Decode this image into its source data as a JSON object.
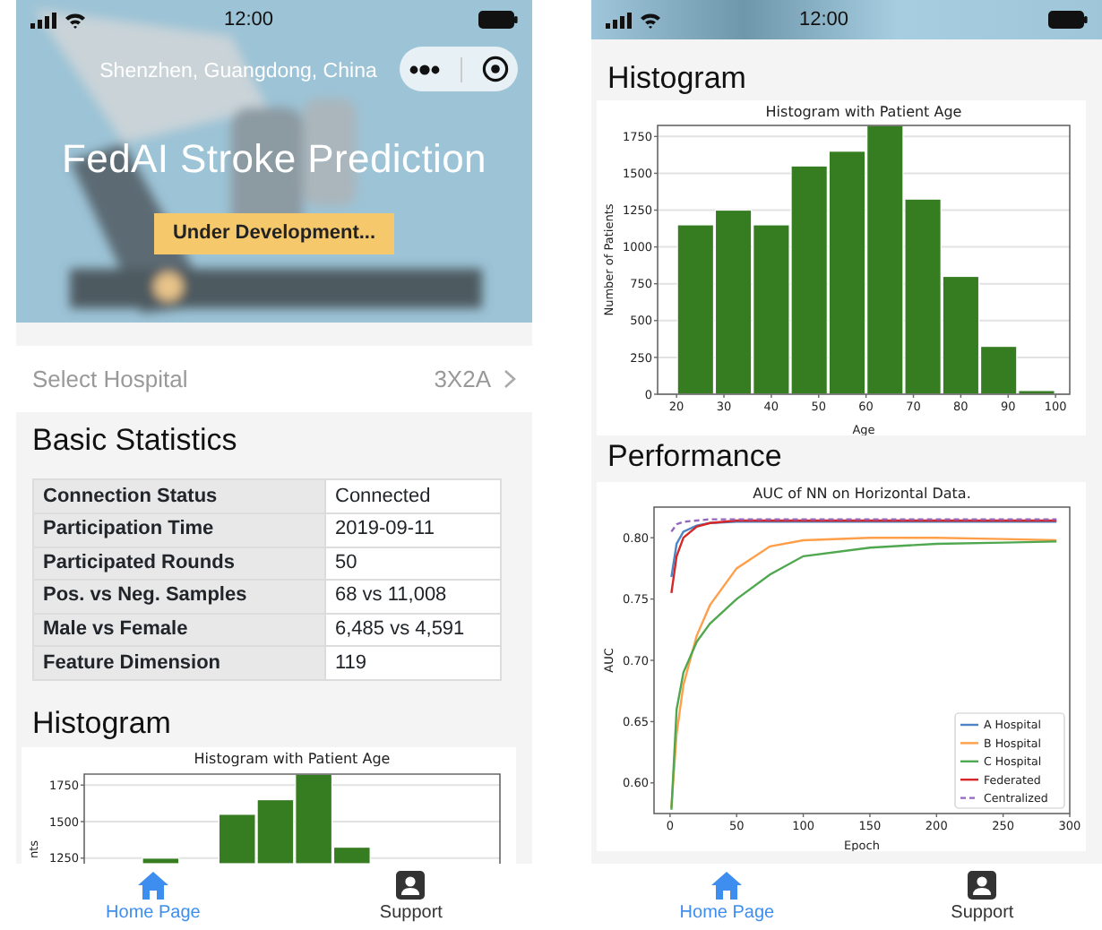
{
  "screens": [
    {
      "status_bar": {
        "time": "12:00"
      },
      "header": {
        "location": "Shenzhen, Guangdong, China",
        "title": "FedAI Stroke Prediction",
        "badge": "Under Development..."
      },
      "hospital_select": {
        "label": "Select Hospital",
        "value": "3X2A"
      },
      "basic_statistics": {
        "heading": "Basic Statistics",
        "rows": [
          {
            "label": "Connection Status",
            "value": "Connected"
          },
          {
            "label": "Participation Time",
            "value": "2019-09-11"
          },
          {
            "label": "Participated Rounds",
            "value": "50"
          },
          {
            "label": "Pos. vs Neg. Samples",
            "value": "68 vs 11,008"
          },
          {
            "label": "Male vs Female",
            "value": "6,485 vs 4,591"
          },
          {
            "label": "Feature Dimension",
            "value": "119"
          }
        ]
      },
      "histogram": {
        "heading": "Histogram",
        "chart_data": {
          "type": "bar",
          "title": "Histogram with Patient Age",
          "ylabel": "nts",
          "categories": [
            null,
            null,
            null,
            null,
            null,
            null,
            null,
            null,
            null,
            null
          ],
          "values": [
            null,
            1250,
            null,
            1550,
            1650,
            1825,
            1325,
            null,
            null,
            null
          ],
          "ylim": [
            1212,
            1825
          ],
          "yticks": [
            1250,
            1500,
            1750
          ],
          "grid": true
        }
      },
      "tab_bar": [
        {
          "label": "Home Page",
          "selected": true
        },
        {
          "label": "Support",
          "selected": false
        }
      ]
    },
    {
      "status_bar": {
        "time": "12:00"
      },
      "histogram": {
        "heading": "Histogram",
        "chart_data": {
          "type": "bar",
          "title": "Histogram with Patient Age",
          "xlabel": "Age",
          "ylabel": "Number of Patients",
          "x": [
            24,
            32,
            40,
            48,
            56,
            64,
            72,
            80,
            88,
            96
          ],
          "values": [
            1150,
            1250,
            1150,
            1550,
            1650,
            1825,
            1325,
            800,
            325,
            25
          ],
          "xlim": [
            16,
            103
          ],
          "ylim": [
            0,
            1825
          ],
          "xticks": [
            20,
            30,
            40,
            50,
            60,
            70,
            80,
            90,
            100
          ],
          "yticks": [
            0,
            250,
            500,
            750,
            1000,
            1250,
            1500,
            1750
          ],
          "grid": true
        }
      },
      "performance": {
        "heading": "Performance",
        "chart_data": {
          "type": "line",
          "title": "AUC of NN on Horizontal Data.",
          "xlabel": "Epoch",
          "ylabel": "AUC",
          "x": [
            1,
            5,
            10,
            20,
            30,
            50,
            75,
            100,
            150,
            200,
            250,
            290
          ],
          "series": [
            {
              "name": "A Hospital",
              "color": "#4c84c4",
              "line_style": "solid",
              "values": [
                0.768,
                0.795,
                0.805,
                0.81,
                0.812,
                0.813,
                0.813,
                0.813,
                0.813,
                0.813,
                0.813,
                0.813
              ]
            },
            {
              "name": "B Hospital",
              "color": "#ff9f4a",
              "line_style": "solid",
              "values": [
                0.58,
                0.64,
                0.68,
                0.72,
                0.745,
                0.775,
                0.793,
                0.798,
                0.8,
                0.8,
                0.799,
                0.798
              ]
            },
            {
              "name": "C Hospital",
              "color": "#4fa84f",
              "line_style": "solid",
              "values": [
                0.578,
                0.66,
                0.69,
                0.715,
                0.73,
                0.75,
                0.77,
                0.785,
                0.792,
                0.795,
                0.796,
                0.797
              ]
            },
            {
              "name": "Federated",
              "color": "#d62728",
              "line_style": "solid",
              "values": [
                0.755,
                0.785,
                0.8,
                0.809,
                0.812,
                0.814,
                0.814,
                0.814,
                0.814,
                0.814,
                0.814,
                0.814
              ]
            },
            {
              "name": "Centralized",
              "color": "#9467bd",
              "line_style": "dashed",
              "values": [
                0.805,
                0.811,
                0.813,
                0.814,
                0.815,
                0.815,
                0.815,
                0.815,
                0.815,
                0.815,
                0.815,
                0.815
              ]
            }
          ],
          "legend": true,
          "xlim": [
            -12,
            300
          ],
          "ylim": [
            0.575,
            0.825
          ],
          "xticks": [
            0,
            50,
            100,
            150,
            200,
            250,
            300
          ],
          "yticks": [
            {
              "value": 0.6,
              "label": "0.60"
            },
            {
              "value": 0.65,
              "label": "0.65"
            },
            {
              "value": 0.7,
              "label": "0.70"
            },
            {
              "value": 0.75,
              "label": "0.75"
            },
            {
              "value": 0.8,
              "label": "0.80"
            }
          ]
        }
      },
      "tab_bar": [
        {
          "label": "Home Page",
          "selected": true
        },
        {
          "label": "Support",
          "selected": false
        }
      ]
    }
  ]
}
